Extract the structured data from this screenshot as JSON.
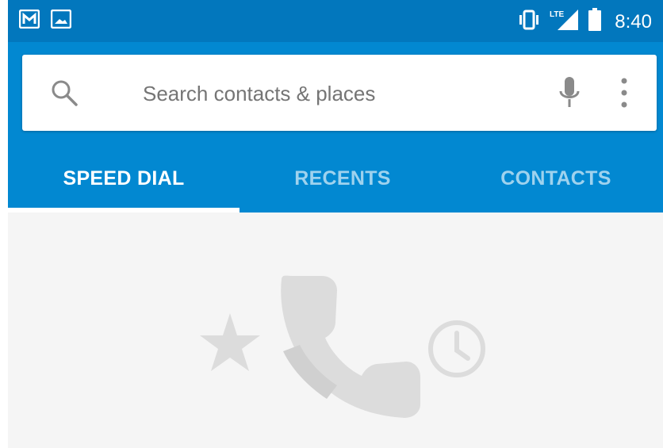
{
  "status_bar": {
    "time": "8:40",
    "left_icons": [
      "gmail-notification-icon",
      "gallery-notification-icon"
    ],
    "right_icons": [
      "vibrate-icon",
      "lte-signal-icon",
      "battery-icon"
    ],
    "network_label": "LTE"
  },
  "search": {
    "placeholder": "Search contacts & places",
    "icons": [
      "search-icon",
      "microphone-icon",
      "overflow-menu-icon"
    ]
  },
  "tabs": [
    {
      "label": "SPEED DIAL",
      "active": true
    },
    {
      "label": "RECENTS",
      "active": false
    },
    {
      "label": "CONTACTS",
      "active": false
    }
  ],
  "empty_state": {
    "icons": [
      "star-icon",
      "phone-icon",
      "clock-icon"
    ]
  },
  "colors": {
    "status_bar": "#0277bd",
    "app_bar": "#0288d1",
    "content_background": "#f5f5f5",
    "empty_icon": "#dcdcdc"
  }
}
